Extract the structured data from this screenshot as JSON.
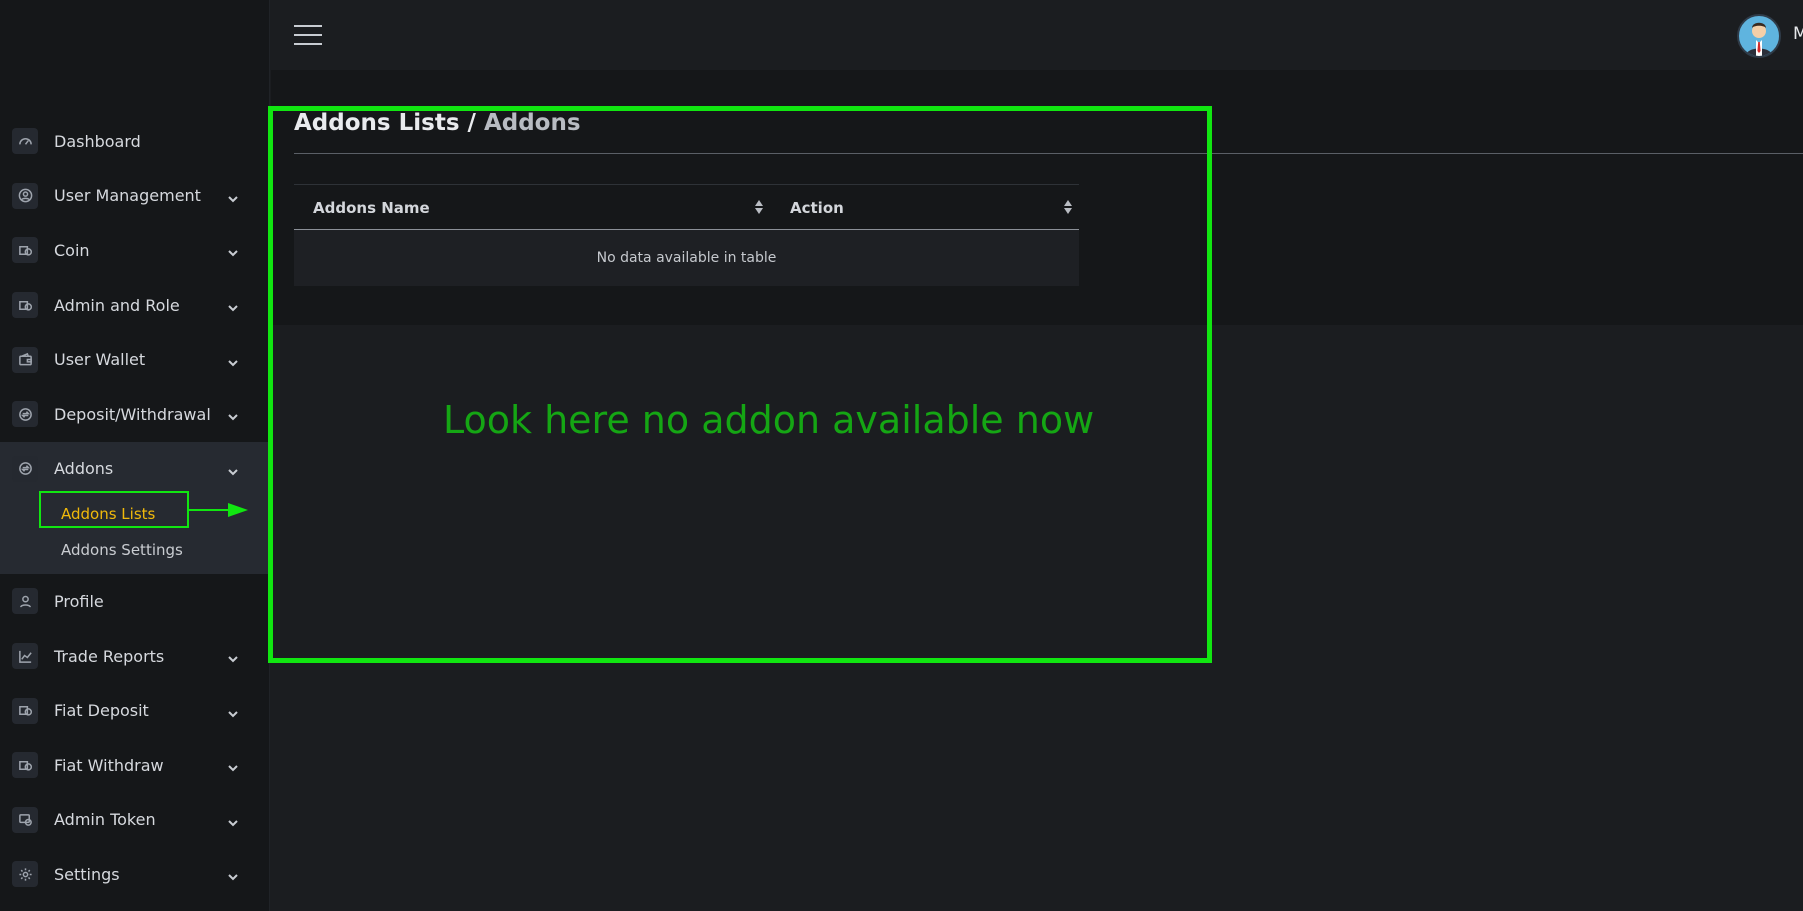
{
  "sidebar": {
    "items": [
      {
        "label": "Dashboard",
        "icon": "speedometer-icon",
        "has_chevron": false
      },
      {
        "label": "User Management",
        "icon": "user-circle-icon",
        "has_chevron": true
      },
      {
        "label": "Coin",
        "icon": "coin-icon",
        "has_chevron": true
      },
      {
        "label": "Admin and Role",
        "icon": "coin-icon",
        "has_chevron": true
      },
      {
        "label": "User Wallet",
        "icon": "wallet-icon",
        "has_chevron": true
      },
      {
        "label": "Deposit/Withdrawal",
        "icon": "exchange-icon",
        "has_chevron": true
      },
      {
        "label": "Addons",
        "icon": "exchange-icon",
        "has_chevron": true
      },
      {
        "label": "Profile",
        "icon": "user-icon",
        "has_chevron": false
      },
      {
        "label": "Trade Reports",
        "icon": "chart-line-icon",
        "has_chevron": true
      },
      {
        "label": "Fiat Deposit",
        "icon": "coin-icon",
        "has_chevron": true
      },
      {
        "label": "Fiat Withdraw",
        "icon": "coin-icon",
        "has_chevron": true
      },
      {
        "label": "Admin Token",
        "icon": "token-icon",
        "has_chevron": true
      },
      {
        "label": "Settings",
        "icon": "gear-icon",
        "has_chevron": true
      }
    ],
    "addons_sub": [
      {
        "label": "Addons Lists",
        "active": true
      },
      {
        "label": "Addons Settings",
        "active": false
      }
    ]
  },
  "header": {
    "user_name": "M"
  },
  "page": {
    "title": "Addons Lists /",
    "crumb": "Addons"
  },
  "table": {
    "columns": [
      "Addons Name",
      "Action"
    ],
    "empty_message": "No data available in table"
  },
  "annotation": {
    "text": "Look here no addon available now",
    "color": "#11e611"
  },
  "colors": {
    "active_submenu": "#f0b90b",
    "background": "#1b1d20",
    "sidebar": "#151719"
  }
}
